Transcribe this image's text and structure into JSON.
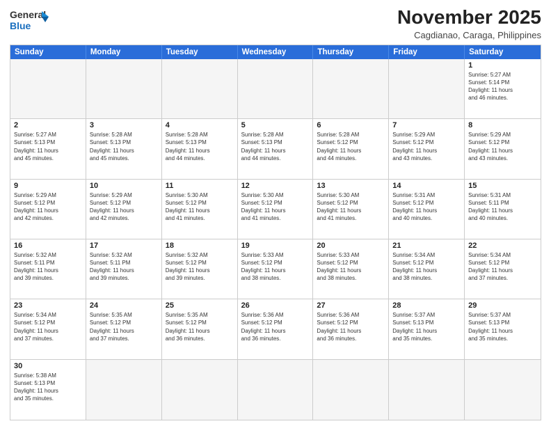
{
  "header": {
    "logo_line1": "General",
    "logo_line2": "Blue",
    "title": "November 2025",
    "subtitle": "Cagdianao, Caraga, Philippines"
  },
  "weekdays": [
    "Sunday",
    "Monday",
    "Tuesday",
    "Wednesday",
    "Thursday",
    "Friday",
    "Saturday"
  ],
  "weeks": [
    [
      {
        "day": "",
        "info": ""
      },
      {
        "day": "",
        "info": ""
      },
      {
        "day": "",
        "info": ""
      },
      {
        "day": "",
        "info": ""
      },
      {
        "day": "",
        "info": ""
      },
      {
        "day": "",
        "info": ""
      },
      {
        "day": "1",
        "info": "Sunrise: 5:27 AM\nSunset: 5:14 PM\nDaylight: 11 hours\nand 46 minutes."
      }
    ],
    [
      {
        "day": "2",
        "info": "Sunrise: 5:27 AM\nSunset: 5:13 PM\nDaylight: 11 hours\nand 45 minutes."
      },
      {
        "day": "3",
        "info": "Sunrise: 5:28 AM\nSunset: 5:13 PM\nDaylight: 11 hours\nand 45 minutes."
      },
      {
        "day": "4",
        "info": "Sunrise: 5:28 AM\nSunset: 5:13 PM\nDaylight: 11 hours\nand 44 minutes."
      },
      {
        "day": "5",
        "info": "Sunrise: 5:28 AM\nSunset: 5:13 PM\nDaylight: 11 hours\nand 44 minutes."
      },
      {
        "day": "6",
        "info": "Sunrise: 5:28 AM\nSunset: 5:12 PM\nDaylight: 11 hours\nand 44 minutes."
      },
      {
        "day": "7",
        "info": "Sunrise: 5:29 AM\nSunset: 5:12 PM\nDaylight: 11 hours\nand 43 minutes."
      },
      {
        "day": "8",
        "info": "Sunrise: 5:29 AM\nSunset: 5:12 PM\nDaylight: 11 hours\nand 43 minutes."
      }
    ],
    [
      {
        "day": "9",
        "info": "Sunrise: 5:29 AM\nSunset: 5:12 PM\nDaylight: 11 hours\nand 42 minutes."
      },
      {
        "day": "10",
        "info": "Sunrise: 5:29 AM\nSunset: 5:12 PM\nDaylight: 11 hours\nand 42 minutes."
      },
      {
        "day": "11",
        "info": "Sunrise: 5:30 AM\nSunset: 5:12 PM\nDaylight: 11 hours\nand 41 minutes."
      },
      {
        "day": "12",
        "info": "Sunrise: 5:30 AM\nSunset: 5:12 PM\nDaylight: 11 hours\nand 41 minutes."
      },
      {
        "day": "13",
        "info": "Sunrise: 5:30 AM\nSunset: 5:12 PM\nDaylight: 11 hours\nand 41 minutes."
      },
      {
        "day": "14",
        "info": "Sunrise: 5:31 AM\nSunset: 5:12 PM\nDaylight: 11 hours\nand 40 minutes."
      },
      {
        "day": "15",
        "info": "Sunrise: 5:31 AM\nSunset: 5:11 PM\nDaylight: 11 hours\nand 40 minutes."
      }
    ],
    [
      {
        "day": "16",
        "info": "Sunrise: 5:32 AM\nSunset: 5:11 PM\nDaylight: 11 hours\nand 39 minutes."
      },
      {
        "day": "17",
        "info": "Sunrise: 5:32 AM\nSunset: 5:11 PM\nDaylight: 11 hours\nand 39 minutes."
      },
      {
        "day": "18",
        "info": "Sunrise: 5:32 AM\nSunset: 5:12 PM\nDaylight: 11 hours\nand 39 minutes."
      },
      {
        "day": "19",
        "info": "Sunrise: 5:33 AM\nSunset: 5:12 PM\nDaylight: 11 hours\nand 38 minutes."
      },
      {
        "day": "20",
        "info": "Sunrise: 5:33 AM\nSunset: 5:12 PM\nDaylight: 11 hours\nand 38 minutes."
      },
      {
        "day": "21",
        "info": "Sunrise: 5:34 AM\nSunset: 5:12 PM\nDaylight: 11 hours\nand 38 minutes."
      },
      {
        "day": "22",
        "info": "Sunrise: 5:34 AM\nSunset: 5:12 PM\nDaylight: 11 hours\nand 37 minutes."
      }
    ],
    [
      {
        "day": "23",
        "info": "Sunrise: 5:34 AM\nSunset: 5:12 PM\nDaylight: 11 hours\nand 37 minutes."
      },
      {
        "day": "24",
        "info": "Sunrise: 5:35 AM\nSunset: 5:12 PM\nDaylight: 11 hours\nand 37 minutes."
      },
      {
        "day": "25",
        "info": "Sunrise: 5:35 AM\nSunset: 5:12 PM\nDaylight: 11 hours\nand 36 minutes."
      },
      {
        "day": "26",
        "info": "Sunrise: 5:36 AM\nSunset: 5:12 PM\nDaylight: 11 hours\nand 36 minutes."
      },
      {
        "day": "27",
        "info": "Sunrise: 5:36 AM\nSunset: 5:12 PM\nDaylight: 11 hours\nand 36 minutes."
      },
      {
        "day": "28",
        "info": "Sunrise: 5:37 AM\nSunset: 5:13 PM\nDaylight: 11 hours\nand 35 minutes."
      },
      {
        "day": "29",
        "info": "Sunrise: 5:37 AM\nSunset: 5:13 PM\nDaylight: 11 hours\nand 35 minutes."
      }
    ],
    [
      {
        "day": "30",
        "info": "Sunrise: 5:38 AM\nSunset: 5:13 PM\nDaylight: 11 hours\nand 35 minutes."
      },
      {
        "day": "",
        "info": ""
      },
      {
        "day": "",
        "info": ""
      },
      {
        "day": "",
        "info": ""
      },
      {
        "day": "",
        "info": ""
      },
      {
        "day": "",
        "info": ""
      },
      {
        "day": "",
        "info": ""
      }
    ]
  ]
}
